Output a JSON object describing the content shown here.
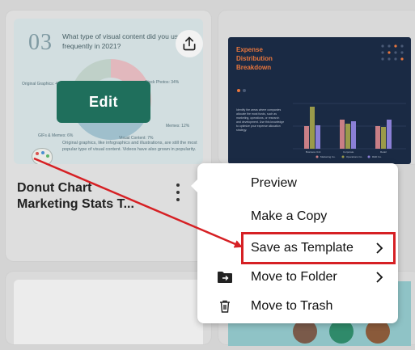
{
  "main_card": {
    "title": "Donut Chart Marketing Stats T...",
    "edit_label": "Edit",
    "thumbnail": {
      "number": "03",
      "question": "What type of visual content did you use most frequently in 2021?",
      "slice_labels": [
        "Original Graphics: 40%",
        "Stock Photos: 34%",
        "Memes: 12%",
        "GIFs & Memes: 6%",
        "Visual Content: 7%"
      ],
      "footnote": "Original graphics, like infographics and illustrations, are still the most popular type of visual content. Videos have also grown in popularity."
    }
  },
  "right_card": {
    "title_line1": "Expense",
    "title_line2": "Distribution",
    "title_line3": "Breakdown",
    "categories": [
      "Business Unit",
      "Corporate",
      "Retail"
    ],
    "legend": [
      "Marketing Co.",
      "Operations Co.",
      "R&D Co."
    ],
    "description": "Identify the areas where companies allocate the most funds, such as marketing, operations, or research and development. Use this knowledge to optimize your expense allocation strategy."
  },
  "context_menu": {
    "items": [
      {
        "label": "Preview",
        "icon": "",
        "has_submenu": false
      },
      {
        "label": "Make a Copy",
        "icon": "",
        "has_submenu": false
      },
      {
        "label": "Save as Template",
        "icon": "",
        "has_submenu": true
      },
      {
        "label": "Move to Folder",
        "icon": "folder-move-icon",
        "has_submenu": true
      },
      {
        "label": "Move to Trash",
        "icon": "trash-icon",
        "has_submenu": false
      }
    ]
  },
  "colors": {
    "edit_button": "#1f6f5c",
    "highlight": "#d62024",
    "dashboard_bg": "#1a2a44",
    "dashboard_accent": "#e9763d"
  }
}
